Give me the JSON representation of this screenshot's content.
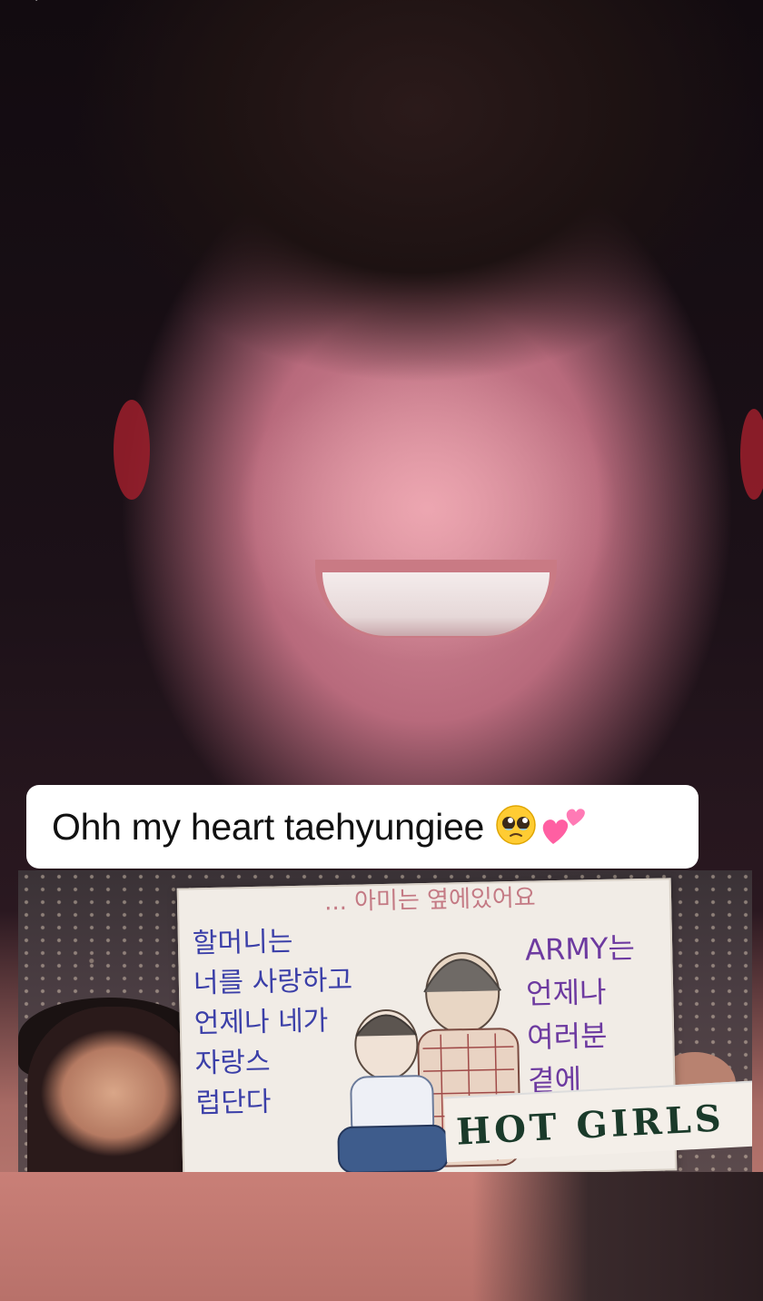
{
  "caption": {
    "text": "Ohh my heart taehyungiee",
    "emoji": [
      "pleading-face-emoji",
      "two-hearts-emoji"
    ]
  },
  "navigation": {
    "back_icon": "chevron-left-icon"
  },
  "inset_image": {
    "poster_top_text": "... 아미는 옆에있어요",
    "poster_left_lines": "할머니는\n너를 사랑하고\n언제나 네가\n자랑스\n럽단다",
    "poster_right_lines": "ARMY는\n언제나\n여러분\n곁에",
    "banner_text": "HOT GIRLS"
  },
  "colors": {
    "caption_bg": "#ffffff",
    "caption_text": "#111111",
    "poster_blue_ink": "#3b3fa8",
    "poster_purple_ink": "#6d3aa0"
  }
}
